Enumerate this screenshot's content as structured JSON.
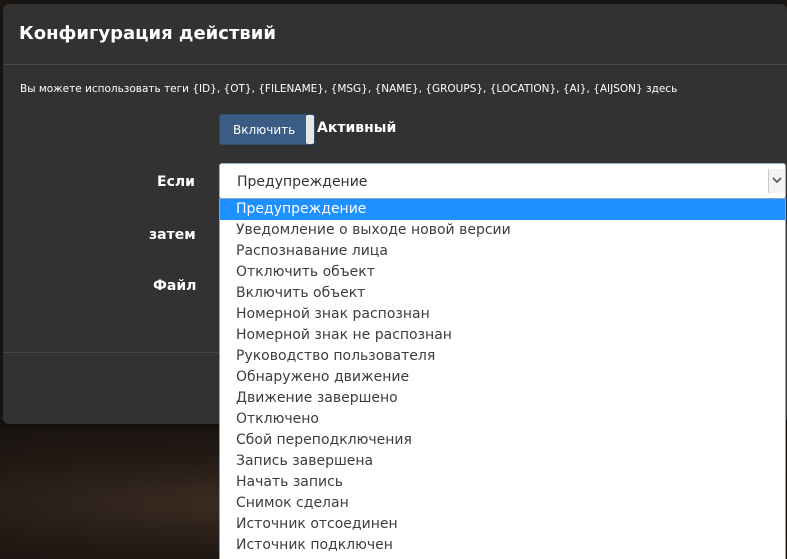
{
  "modal": {
    "title": "Конфигурация действий",
    "hint": "Вы можете использовать теги {ID}, {OT}, {FILENAME}, {MSG}, {NAME}, {GROUPS}, {LOCATION}, {AI}, {AIJSON} здесь",
    "toggle": {
      "label": "Включить",
      "status": "Активный"
    },
    "fields": {
      "if_label": "Если",
      "then_label": "затем",
      "file_label": "Файл"
    },
    "select": {
      "value": "Предупреждение",
      "options": [
        "Предупреждение",
        "Уведомление о выходе новой версии",
        "Распознавание лица",
        "Отключить объект",
        "Включить объект",
        "Номерной знак распознан",
        "Номерной знак не распознан",
        "Руководство пользователя",
        "Обнаружено движение",
        "Движение завершено",
        "Отключено",
        "Сбой переподключения",
        "Запись завершена",
        "Начать запись",
        "Снимок сделан",
        "Источник отсоединен",
        "Источник подключен"
      ],
      "selected_index": 0
    }
  },
  "colors": {
    "modal_bg": "#323232",
    "accent": "#1e90ff",
    "toggle_bg": "#3b5c84"
  }
}
